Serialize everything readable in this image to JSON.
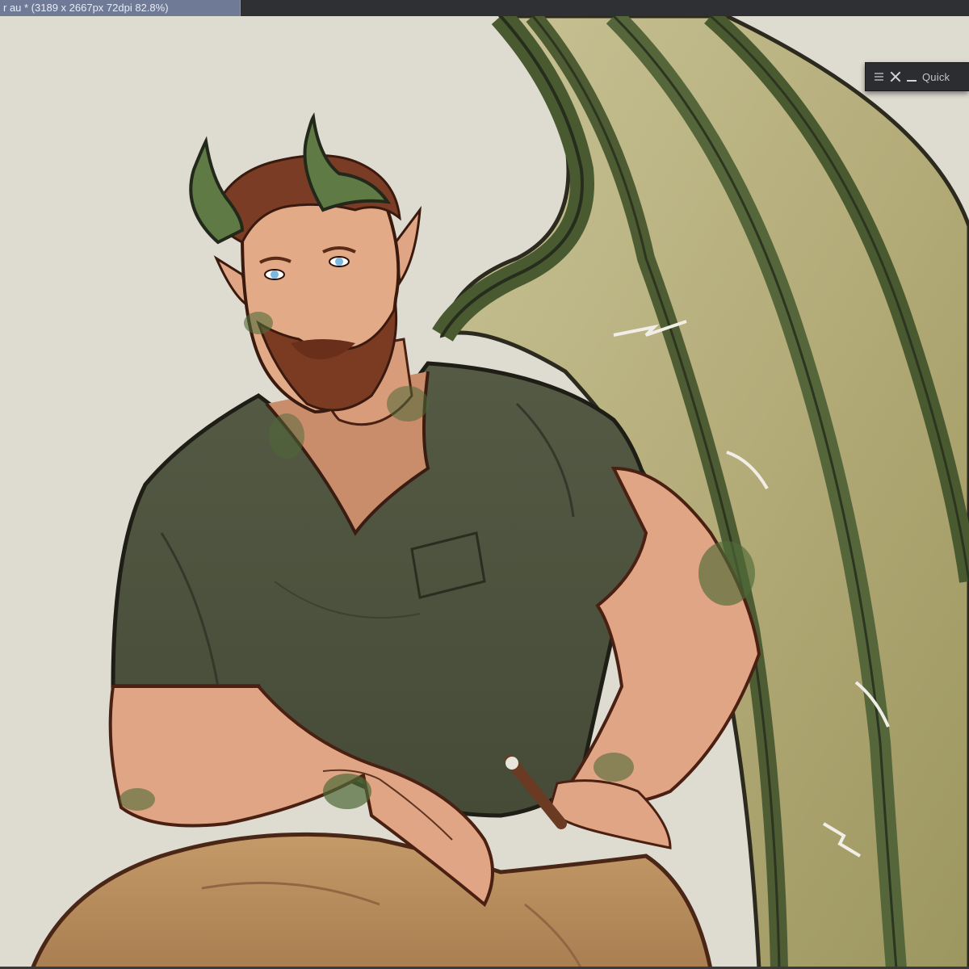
{
  "document_tab": {
    "title": "r au * (3189 x 2667px 72dpi 82.8%)"
  },
  "quick_palette": {
    "label": "Quick",
    "icons": [
      "menu-icon",
      "close-icon",
      "minimize-icon"
    ]
  },
  "canvas": {
    "background": "#dedbd0",
    "artwork": "digital painting in progress"
  },
  "colors": {
    "shirt": "#4f5540",
    "skin": "#e2a886",
    "hair": "#7a3c24",
    "wing_membrane": "#b5ad78",
    "wing_bone": "#4d5c33",
    "pants": "#b58a5c",
    "tattoo": "#3f5a2c"
  }
}
